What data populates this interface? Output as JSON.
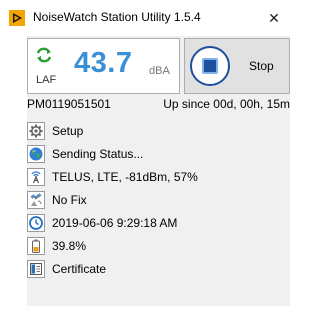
{
  "window": {
    "title": "NoiseWatch Station Utility 1.5.4",
    "close_glyph": "✕"
  },
  "level": {
    "icon": "refresh-arrows-icon",
    "weighting": "LAF",
    "value": "43.7",
    "unit": "dBA",
    "value_color": "#3a8fd6"
  },
  "control": {
    "stop_label": "Stop",
    "icon": "stop-icon"
  },
  "station": {
    "serial": "PM0119051501",
    "uptime": "Up since 00d, 00h, 15m"
  },
  "status": [
    {
      "icon": "gear-icon",
      "text": "Setup"
    },
    {
      "icon": "globe-icon",
      "text": "Sending Status..."
    },
    {
      "icon": "signal-antenna-icon",
      "text": "TELUS, LTE, -81dBm, 57%"
    },
    {
      "icon": "gps-satellite-icon",
      "text": "No Fix"
    },
    {
      "icon": "clock-icon",
      "text": "2019-06-06 9:29:18 AM"
    },
    {
      "icon": "battery-icon",
      "text": "39.8%"
    },
    {
      "icon": "certificate-icon",
      "text": "Certificate"
    }
  ]
}
